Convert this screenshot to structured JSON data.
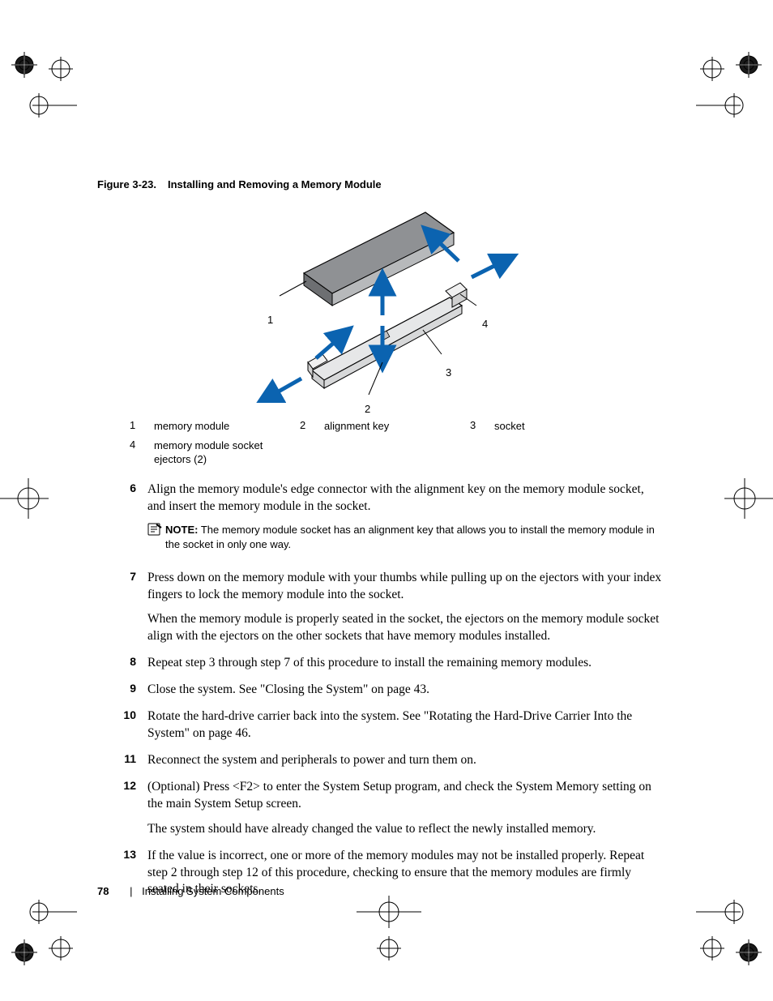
{
  "figure": {
    "label": "Figure 3-23.",
    "title": "Installing and Removing a Memory Module",
    "callouts": {
      "c1": "1",
      "c2": "2",
      "c3": "3",
      "c4": "4"
    }
  },
  "legend": {
    "i1": {
      "num": "1",
      "text": "memory module"
    },
    "i2": {
      "num": "2",
      "text": "alignment key"
    },
    "i3": {
      "num": "3",
      "text": "socket"
    },
    "i4": {
      "num": "4",
      "text": "memory module socket ejectors (2)"
    }
  },
  "steps": {
    "s6": {
      "num": "6",
      "p1": "Align the memory module's edge connector with the alignment key on the memory module socket, and insert the memory module in the socket.",
      "note_label": "NOTE:",
      "note_text": " The memory module socket has an alignment key that allows you to install the memory module in the socket in only one way."
    },
    "s7": {
      "num": "7",
      "p1": "Press down on the memory module with your thumbs while pulling up on the ejectors with your index fingers to lock the memory module into the socket.",
      "p2": "When the memory module is properly seated in the socket, the ejectors on the memory module socket align with the ejectors on the other sockets that have memory modules installed."
    },
    "s8": {
      "num": "8",
      "p1": "Repeat step 3 through step 7 of this procedure to install the remaining memory modules."
    },
    "s9": {
      "num": "9",
      "p1": "Close the system. See \"Closing the System\" on page 43."
    },
    "s10": {
      "num": "10",
      "p1": "Rotate the hard-drive carrier back into the system. See \"Rotating the Hard-Drive Carrier Into the System\" on page 46."
    },
    "s11": {
      "num": "11",
      "p1": "Reconnect the system and peripherals to power and turn them on."
    },
    "s12": {
      "num": "12",
      "p1": "(Optional) Press <F2> to enter the System Setup program, and check the System Memory setting on the main System Setup screen.",
      "p2": "The system should have already changed the value to reflect the newly installed memory."
    },
    "s13": {
      "num": "13",
      "p1": "If the value is incorrect, one or more of the memory modules may not be installed properly. Repeat step 2 through step 12 of this procedure, checking to ensure that the memory modules are firmly seated in their sockets."
    }
  },
  "footer": {
    "page": "78",
    "separator": "|",
    "section": "Installing System Components"
  }
}
